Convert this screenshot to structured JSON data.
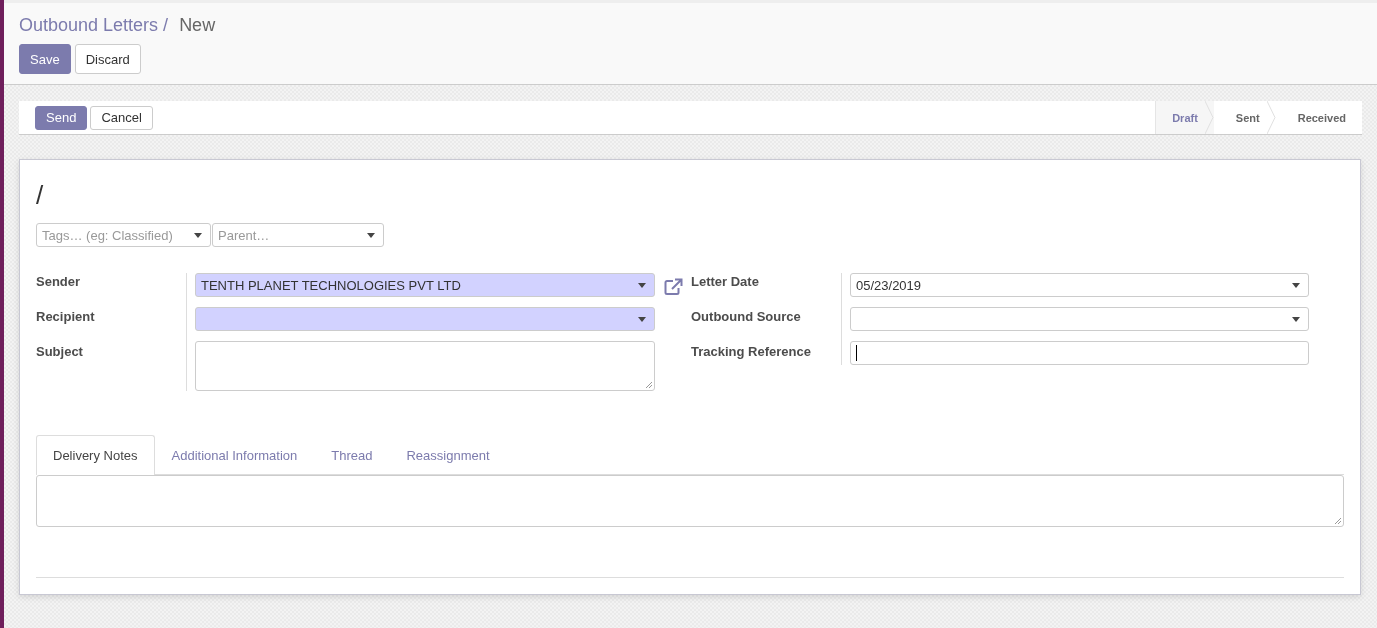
{
  "breadcrumb": {
    "parent": "Outbound Letters",
    "separator": "/",
    "current": "New"
  },
  "actions": [
    {
      "label": "Save",
      "primary": true
    },
    {
      "label": "Discard",
      "primary": false
    }
  ],
  "header_buttons": [
    {
      "label": "Send",
      "primary": true
    },
    {
      "label": "Cancel",
      "primary": false
    }
  ],
  "status_stages": [
    {
      "label": "Draft",
      "selected": true
    },
    {
      "label": "Sent",
      "selected": false
    },
    {
      "label": "Received",
      "selected": false
    }
  ],
  "title": "/",
  "tags_field": {
    "placeholder": "Tags… (eg: Classified)"
  },
  "parent_field": {
    "placeholder": "Parent…"
  },
  "left_fields": [
    {
      "label": "Sender",
      "kind": "select",
      "value": "TENTH PLANET TECHNOLOGIES PVT LTD",
      "required": true
    },
    {
      "label": "Recipient",
      "kind": "select",
      "required": true
    },
    {
      "label": "Subject",
      "kind": "textarea",
      "required": false
    }
  ],
  "right_fields": [
    {
      "label": "Letter Date",
      "kind": "select",
      "value": "05/23/2019",
      "required": false
    },
    {
      "label": "Outbound Source",
      "kind": "select",
      "required": false
    },
    {
      "label": "Tracking Reference",
      "kind": "text",
      "required": false
    }
  ],
  "tabs": [
    {
      "label": "Delivery Notes",
      "selected": true
    },
    {
      "label": "Additional Information",
      "selected": false
    },
    {
      "label": "Thread",
      "selected": false
    },
    {
      "label": "Reassignment",
      "selected": false
    }
  ]
}
